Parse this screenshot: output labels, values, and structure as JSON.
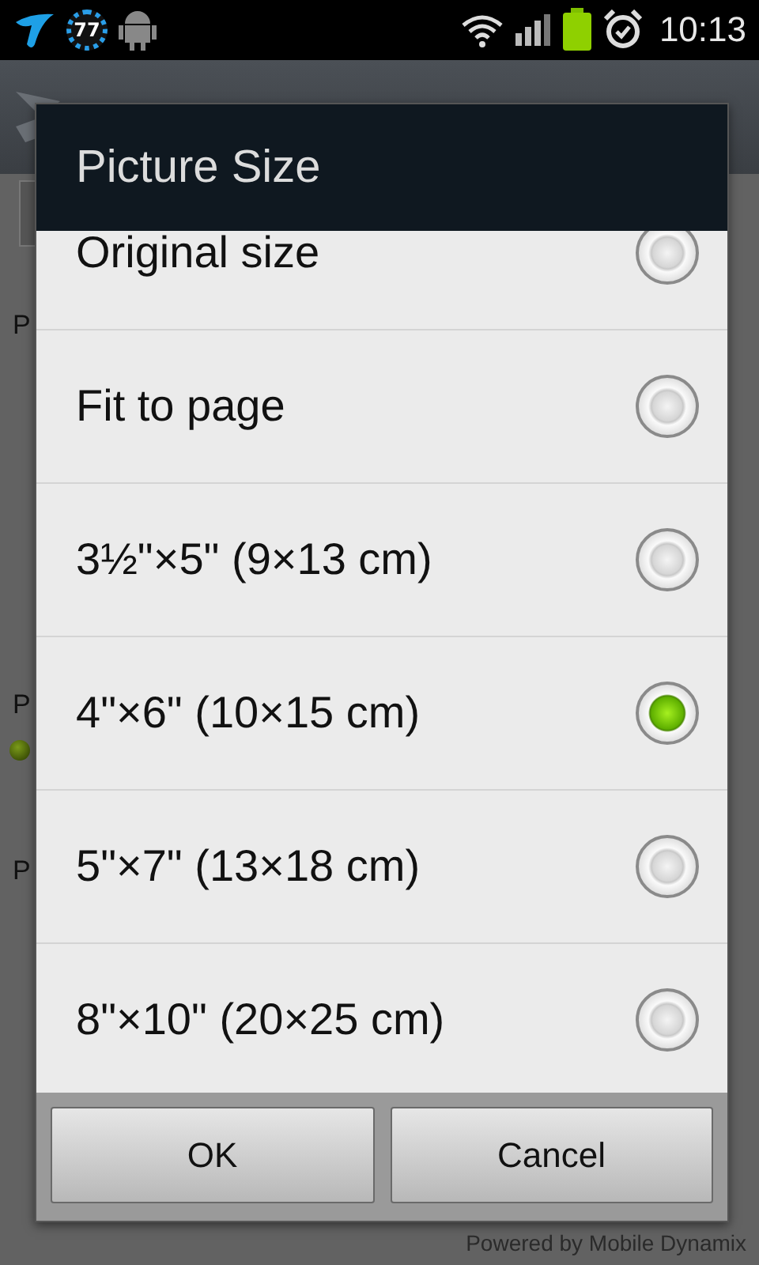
{
  "status_bar": {
    "notification_count": "77",
    "time": "10:13"
  },
  "background": {
    "labels": [
      {
        "text": "P",
        "dot": false
      },
      {
        "text": "P",
        "dot": true
      },
      {
        "text": "P",
        "dot": false
      }
    ]
  },
  "dialog": {
    "title": "Picture Size",
    "options": [
      {
        "label": "Original size",
        "selected": false
      },
      {
        "label": "Fit to page",
        "selected": false
      },
      {
        "label": "3½\"×5\" (9×13 cm)",
        "selected": false
      },
      {
        "label": "4\"×6\" (10×15 cm)",
        "selected": true
      },
      {
        "label": "5\"×7\" (13×18 cm)",
        "selected": false
      },
      {
        "label": "8\"×10\" (20×25 cm)",
        "selected": false
      }
    ],
    "buttons": [
      "OK",
      "Cancel"
    ]
  },
  "footer": "Powered by Mobile Dynamix"
}
